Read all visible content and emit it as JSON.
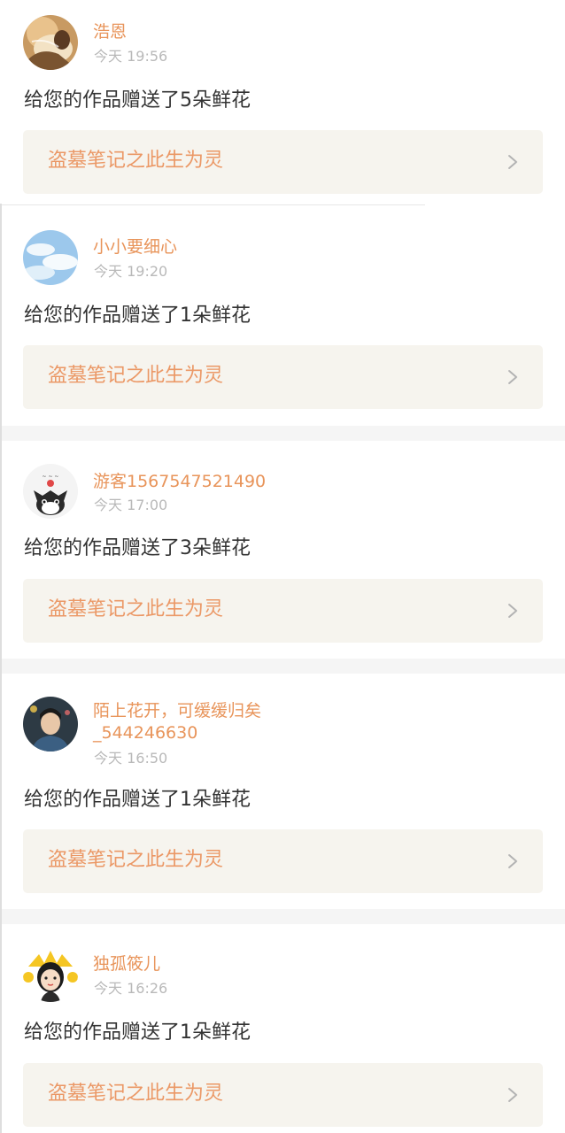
{
  "notifications": [
    {
      "username": "浩恩",
      "time": "今天 19:56",
      "message": "给您的作品赠送了5朵鲜花",
      "book_title": "盗墓笔记之此生为灵",
      "avatar_icon": "portrait-woman-avatar"
    },
    {
      "username": "小小要细心",
      "time": "今天 19:20",
      "message": "给您的作品赠送了1朵鲜花",
      "book_title": "盗墓笔记之此生为灵",
      "avatar_icon": "sky-clouds-avatar"
    },
    {
      "username": "游客1567547521490",
      "time": "今天 17:00",
      "message": "给您的作品赠送了3朵鲜花",
      "book_title": "盗墓笔记之此生为灵",
      "avatar_icon": "cartoon-cat-avatar"
    },
    {
      "username_line1": "陌上花开，可缓缓归矣",
      "username_line2": "_544246630",
      "time": "今天 16:50",
      "message": "给您的作品赠送了1朵鲜花",
      "book_title": "盗墓笔记之此生为灵",
      "avatar_icon": "portrait-man-avatar"
    },
    {
      "username": "独孤筱儿",
      "time": "今天 16:26",
      "message": "给您的作品赠送了1朵鲜花",
      "book_title": "盗墓笔记之此生为灵",
      "avatar_icon": "cartoon-girl-avatar"
    }
  ],
  "colors": {
    "username": "#e8945a",
    "book_title": "#eb9866",
    "time": "#b9b9b9",
    "message": "#333333",
    "book_box_bg": "#f6f4ee",
    "separator": "#f5f5f5"
  }
}
